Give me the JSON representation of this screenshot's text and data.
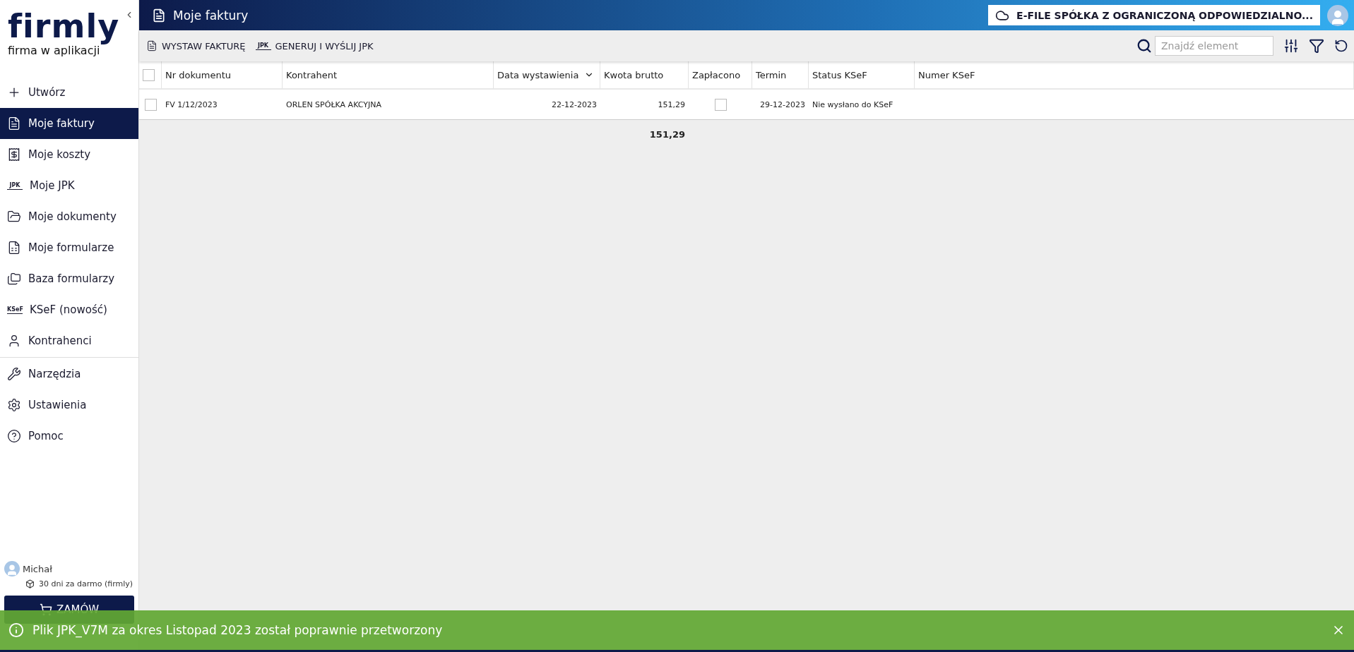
{
  "sidebar": {
    "logo": "firmly",
    "tagline": "firma w aplikacji",
    "items": [
      {
        "label": "Utwórz",
        "kind": "plus",
        "selected": false
      },
      {
        "label": "Moje faktury",
        "kind": "invoice",
        "selected": true
      },
      {
        "label": "Moje koszty",
        "kind": "costs",
        "selected": false
      },
      {
        "label": "Moje JPK",
        "kind": "badge",
        "badge": "JPK",
        "selected": false
      },
      {
        "label": "Moje dokumenty",
        "kind": "folder-open",
        "selected": false
      },
      {
        "label": "Moje formularze",
        "kind": "form",
        "selected": false
      },
      {
        "label": "Baza formularzy",
        "kind": "folders",
        "selected": false
      },
      {
        "label": "KSeF (nowość)",
        "kind": "badge",
        "badge": "KSeF",
        "selected": false
      },
      {
        "label": "Kontrahenci",
        "kind": "user",
        "selected": false
      }
    ],
    "tools": [
      {
        "label": "Narzędzia",
        "kind": "tools",
        "selected": false
      },
      {
        "label": "Ustawienia",
        "kind": "gear",
        "selected": false
      },
      {
        "label": "Pomoc",
        "kind": "help",
        "selected": false
      }
    ],
    "user": {
      "name": "Michał",
      "plan": "30 dni za darmo (firmly)"
    },
    "order_button": "ZAMÓW"
  },
  "header": {
    "title": "Moje faktury",
    "company": "E-FILE SPÓŁKA Z OGRANICZONĄ ODPOWIEDZIALNO..."
  },
  "toolbar": {
    "actions": [
      {
        "label": "WYSTAW FAKTURĘ",
        "kind": "invoice"
      },
      {
        "label": "GENERUJ I WYŚLIJ JPK",
        "kind": "badge",
        "badge": "JPK"
      }
    ],
    "search": {
      "placeholder": "Znajdź element"
    }
  },
  "table": {
    "all_selected": false,
    "columns": [
      {
        "label": "Nr dokumentu",
        "sorted": false
      },
      {
        "label": "Kontrahent",
        "sorted": false
      },
      {
        "label": "Data wystawienia",
        "sorted": true
      },
      {
        "label": "Kwota brutto",
        "sorted": false
      },
      {
        "label": "Zapłacono",
        "sorted": false
      },
      {
        "label": "Termin",
        "sorted": false
      },
      {
        "label": "Status KSeF",
        "sorted": false
      },
      {
        "label": "Numer KSeF",
        "sorted": false
      }
    ],
    "rows": [
      {
        "selected": false,
        "number": "FV 1/12/2023",
        "contractor": "ORLEN SPÓŁKA AKCYJNA",
        "date": "22-12-2023",
        "amount": "151,29",
        "paid": false,
        "due": "29-12-2023",
        "status": "Nie wysłano do KSeF"
      }
    ],
    "total": "151,29"
  },
  "toast": {
    "message": "Plik JPK_V7M za okres Listopad 2023 został poprawnie przetworzony"
  }
}
